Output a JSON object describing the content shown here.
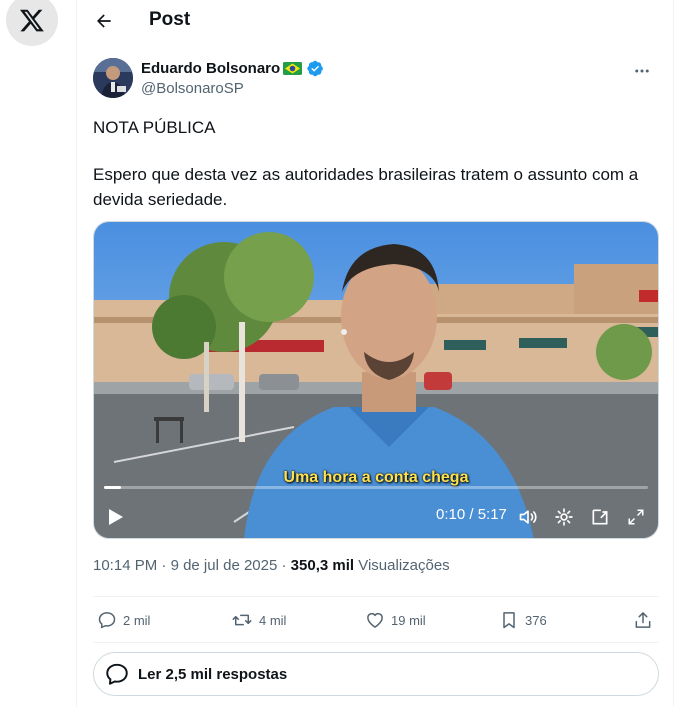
{
  "header": {
    "title": "Post"
  },
  "author": {
    "name": "Eduardo Bolsonaro",
    "handle": "@BolsonaroSP",
    "verified": true,
    "flag": "brazil-flag"
  },
  "tweet": {
    "paragraphs": [
      "NOTA PÚBLICA",
      "Espero que desta vez as autoridades brasileiras tratem o assunto com a devida seriedade."
    ]
  },
  "video": {
    "subtitle": "Uma hora a conta chega",
    "time": "0:10 / 5:17",
    "progress_fraction": 0.032
  },
  "meta": {
    "time": "10:14 PM",
    "date": "9 de jul de 2025",
    "views_count": "350,3 mil",
    "views_label": "Visualizações"
  },
  "actions": {
    "replies": "2 mil",
    "reposts": "4 mil",
    "likes": "19 mil",
    "bookmarks": "376"
  },
  "read_replies": {
    "label": "Ler 2,5 mil respostas"
  },
  "colors": {
    "verified": "#1d9bf0",
    "subtitle": "#ffe14d",
    "text_secondary": "#536471"
  }
}
